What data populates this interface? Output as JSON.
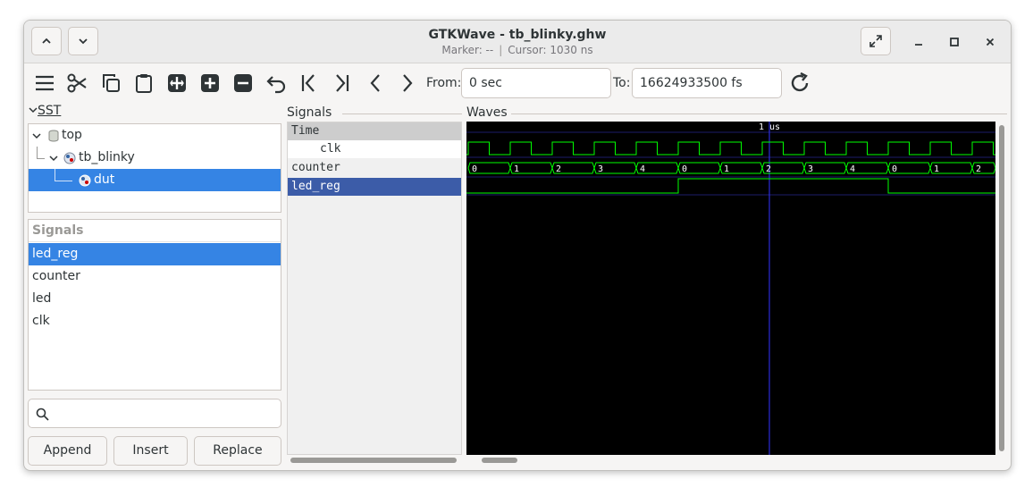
{
  "window": {
    "title": "GTKWave - tb_blinky.ghw",
    "marker": "Marker: --",
    "cursor": "Cursor: 1030 ns"
  },
  "toolbar": {
    "icons": [
      "menu-icon",
      "cut-icon",
      "copy-icon",
      "paste-icon",
      "zoom-fit-icon",
      "zoom-in-icon",
      "zoom-out-icon",
      "undo-icon",
      "goto-start-icon",
      "goto-end-icon",
      "prev-edge-icon",
      "next-edge-icon"
    ],
    "from_label": "From:",
    "from_value": "0 sec",
    "to_label": "To:",
    "to_value": "16624933500 fs",
    "reload": "reload-icon"
  },
  "sst": {
    "label": "SST",
    "tree": [
      {
        "label": "top",
        "depth": 0,
        "expanded": true
      },
      {
        "label": "tb_blinky",
        "depth": 1,
        "expanded": true
      },
      {
        "label": "dut",
        "depth": 2,
        "selected": true
      }
    ],
    "signals_header": "Signals",
    "signals": [
      {
        "label": "led_reg",
        "selected": true
      },
      {
        "label": "counter"
      },
      {
        "label": "led"
      },
      {
        "label": "clk"
      }
    ],
    "search_placeholder": "",
    "buttons": {
      "append": "Append",
      "insert": "Insert",
      "replace": "Replace"
    }
  },
  "signals_panel": {
    "label": "Signals",
    "time_header": "Time",
    "rows": [
      {
        "label": "clk",
        "indent": true
      },
      {
        "label": "counter"
      },
      {
        "label": "led_reg",
        "selected": true
      }
    ]
  },
  "waves": {
    "label": "Waves",
    "time_marker": "1 us",
    "counter_values": [
      "0",
      "1",
      "2",
      "3",
      "4",
      "0",
      "1",
      "2",
      "3",
      "4",
      "0",
      "1",
      "2"
    ],
    "led_reg_levels": [
      0,
      0,
      0,
      0,
      0,
      1,
      1,
      1,
      1,
      1,
      0,
      0,
      0
    ],
    "colors": {
      "background": "#000000",
      "trace": "#00ff00",
      "cursor": "#3333ff",
      "text": "#ffffff"
    }
  }
}
